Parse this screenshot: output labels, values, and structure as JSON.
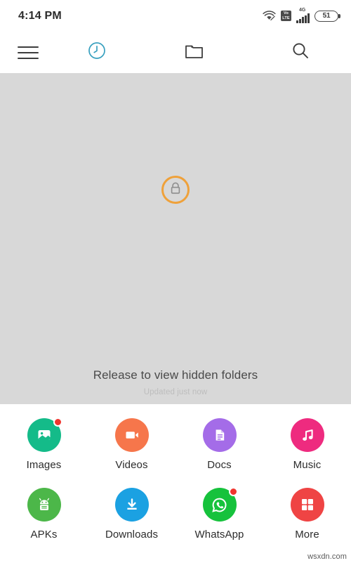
{
  "status_bar": {
    "time": "4:14 PM",
    "icons": {
      "wifi": "wifi-icon",
      "volte_top": "Vo",
      "volte_bottom": "LTE",
      "network_type": "4G",
      "signal": "signal-bars-icon",
      "battery_level": "51"
    }
  },
  "toolbar": {
    "menu_label": "menu",
    "recent_label": "recent",
    "folders_label": "folders",
    "search_label": "search",
    "active_item": "recent",
    "accent_color": "#38a0bf"
  },
  "hidden_panel": {
    "lock_icon": "lock-icon",
    "lock_ring_color": "#efa13a",
    "title": "Release to view hidden folders",
    "subtitle": "Updated just now",
    "background_color": "#d8d8d8"
  },
  "categories": [
    {
      "label": "Images",
      "icon": "image-icon",
      "color": "#14bb89",
      "badge": true
    },
    {
      "label": "Videos",
      "icon": "video-icon",
      "color": "#f6764b",
      "badge": false
    },
    {
      "label": "Docs",
      "icon": "document-icon",
      "color": "#a46ce8",
      "badge": false
    },
    {
      "label": "Music",
      "icon": "music-note-icon",
      "color": "#ee2b7f",
      "badge": false
    },
    {
      "label": "APKs",
      "icon": "android-icon",
      "color": "#4cb749",
      "badge": false
    },
    {
      "label": "Downloads",
      "icon": "download-icon",
      "color": "#1ba1e2",
      "badge": false
    },
    {
      "label": "WhatsApp",
      "icon": "whatsapp-icon",
      "color": "#16c23c",
      "badge": true
    },
    {
      "label": "More",
      "icon": "grid-icon",
      "color": "#ef4444",
      "badge": false
    }
  ],
  "watermark": {
    "text": "wsxdn.com"
  }
}
